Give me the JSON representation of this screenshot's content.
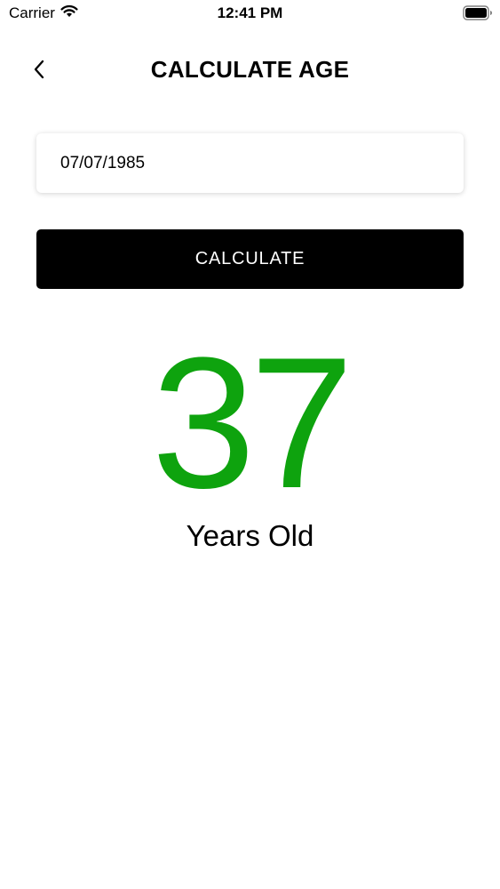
{
  "status_bar": {
    "carrier": "Carrier",
    "time": "12:41 PM"
  },
  "nav": {
    "title": "CALCULATE AGE"
  },
  "form": {
    "date_value": "07/07/1985",
    "button_label": "CALCULATE"
  },
  "result": {
    "age": "37",
    "unit_label": "Years Old"
  },
  "colors": {
    "accent": "#0ea30e",
    "button_bg": "#000000",
    "button_text": "#ffffff"
  }
}
